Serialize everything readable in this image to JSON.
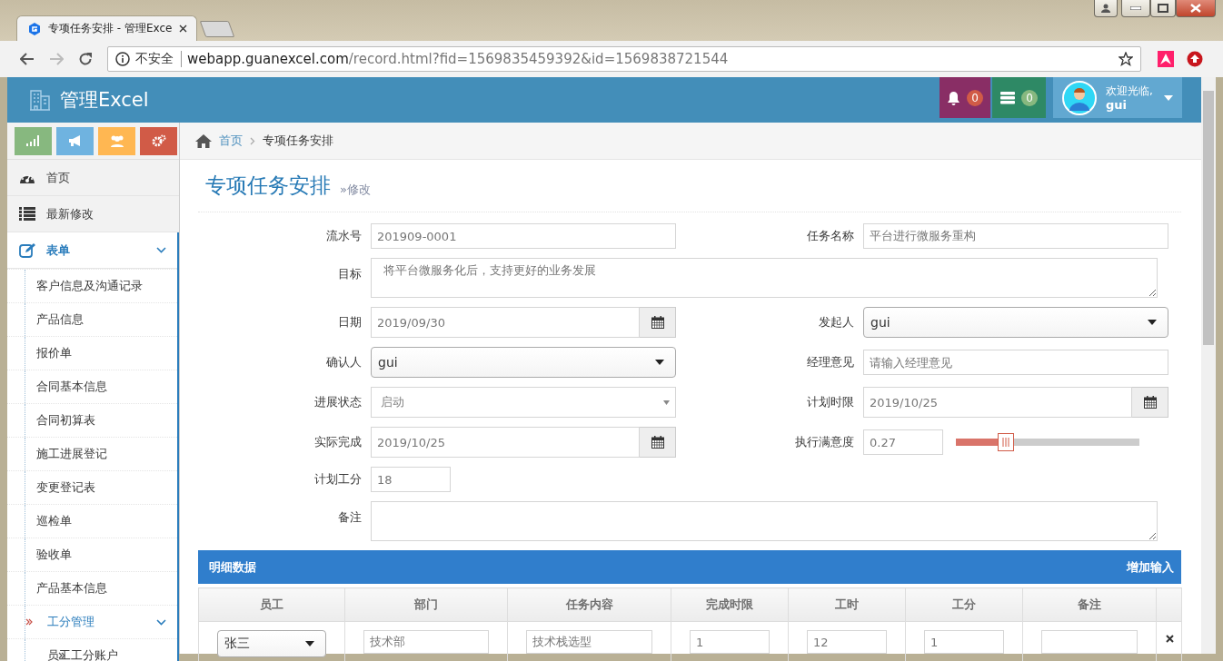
{
  "browser": {
    "tab_title": "专项任务安排 - 管理Exce",
    "security": "不安全",
    "url_host": "webapp.guanexcel.com",
    "url_path": "/record.html?fid=1569835459392&id=1569838721544"
  },
  "header": {
    "title": "管理Excel",
    "notifications": "0",
    "tasks": "0",
    "welcome": "欢迎光临,",
    "user": "gui"
  },
  "shortcuts": [
    {
      "kind": "signal",
      "color": "#87b87f"
    },
    {
      "kind": "bullhorn",
      "color": "#6fb3e0"
    },
    {
      "kind": "users",
      "color": "#ffb752"
    },
    {
      "kind": "cogs",
      "color": "#d15b47"
    }
  ],
  "sidebar": {
    "items": [
      {
        "label": "首页",
        "kind": "dashboard",
        "selected": false
      },
      {
        "label": "最新修改",
        "kind": "list",
        "selected": false
      },
      {
        "label": "表单",
        "kind": "edit",
        "selected": false,
        "expanded": true,
        "children": [
          {
            "label": "客户信息及沟通记录",
            "selected": false
          },
          {
            "label": "产品信息",
            "selected": false
          },
          {
            "label": "报价单",
            "selected": false
          },
          {
            "label": "合同基本信息",
            "selected": false
          },
          {
            "label": "合同初算表",
            "selected": false
          },
          {
            "label": "施工进展登记",
            "selected": false
          },
          {
            "label": "变更登记表",
            "selected": false
          },
          {
            "label": "巡检单",
            "selected": false
          },
          {
            "label": "验收单",
            "selected": false
          },
          {
            "label": "产品基本信息",
            "selected": false
          },
          {
            "label": "工分管理",
            "selected": true,
            "expanded": true,
            "children": [
              {
                "label": "员工工分账户",
                "selected": false
              }
            ]
          }
        ]
      }
    ]
  },
  "breadcrumb": [
    {
      "label": "首页",
      "kind": "home"
    },
    {
      "label": "专项任务安排",
      "kind": "current"
    }
  ],
  "page": {
    "title": "专项任务安排",
    "subtitle": "»修改"
  },
  "form": {
    "fields": [
      {
        "label": "流水号",
        "kind": "text",
        "value": "201909-0001"
      },
      {
        "label": "任务名称",
        "kind": "text",
        "value": "平台进行微服务重构"
      },
      {
        "label": "目标",
        "kind": "textarea",
        "value": "将平台微服务化后，支持更好的业务发展"
      },
      {
        "label": "日期",
        "kind": "date",
        "value": "2019/09/30"
      },
      {
        "label": "发起人",
        "kind": "select",
        "value": "gui"
      },
      {
        "label": "确认人",
        "kind": "select",
        "value": "gui"
      },
      {
        "label": "经理意见",
        "kind": "text",
        "placeholder": "请输入经理意见"
      },
      {
        "label": "进展状态",
        "kind": "native-select",
        "value": "启动"
      },
      {
        "label": "计划时限",
        "kind": "date",
        "value": "2019/10/25"
      },
      {
        "label": "实际完成",
        "kind": "date",
        "value": "2019/10/25"
      },
      {
        "label": "执行满意度",
        "kind": "slider",
        "value": "0.27",
        "level": 0.27
      },
      {
        "label": "计划工分",
        "kind": "number",
        "value": "18"
      },
      {
        "label": "备注",
        "kind": "textarea"
      }
    ]
  },
  "detail": {
    "title": "明细数据",
    "add_link": "增加输入",
    "columns": [
      "员工",
      "部门",
      "任务内容",
      "完成时限",
      "工时",
      "工分",
      "备注"
    ],
    "rows": [
      {
        "cells": [
          {
            "kind": "select",
            "value": "张三"
          },
          {
            "kind": "text",
            "value": "技术部"
          },
          {
            "kind": "text",
            "value": "技术栈选型"
          },
          {
            "kind": "text",
            "value": "1"
          },
          {
            "kind": "text",
            "value": "12"
          },
          {
            "kind": "text",
            "value": "1"
          },
          {
            "kind": "text"
          }
        ]
      }
    ]
  }
}
